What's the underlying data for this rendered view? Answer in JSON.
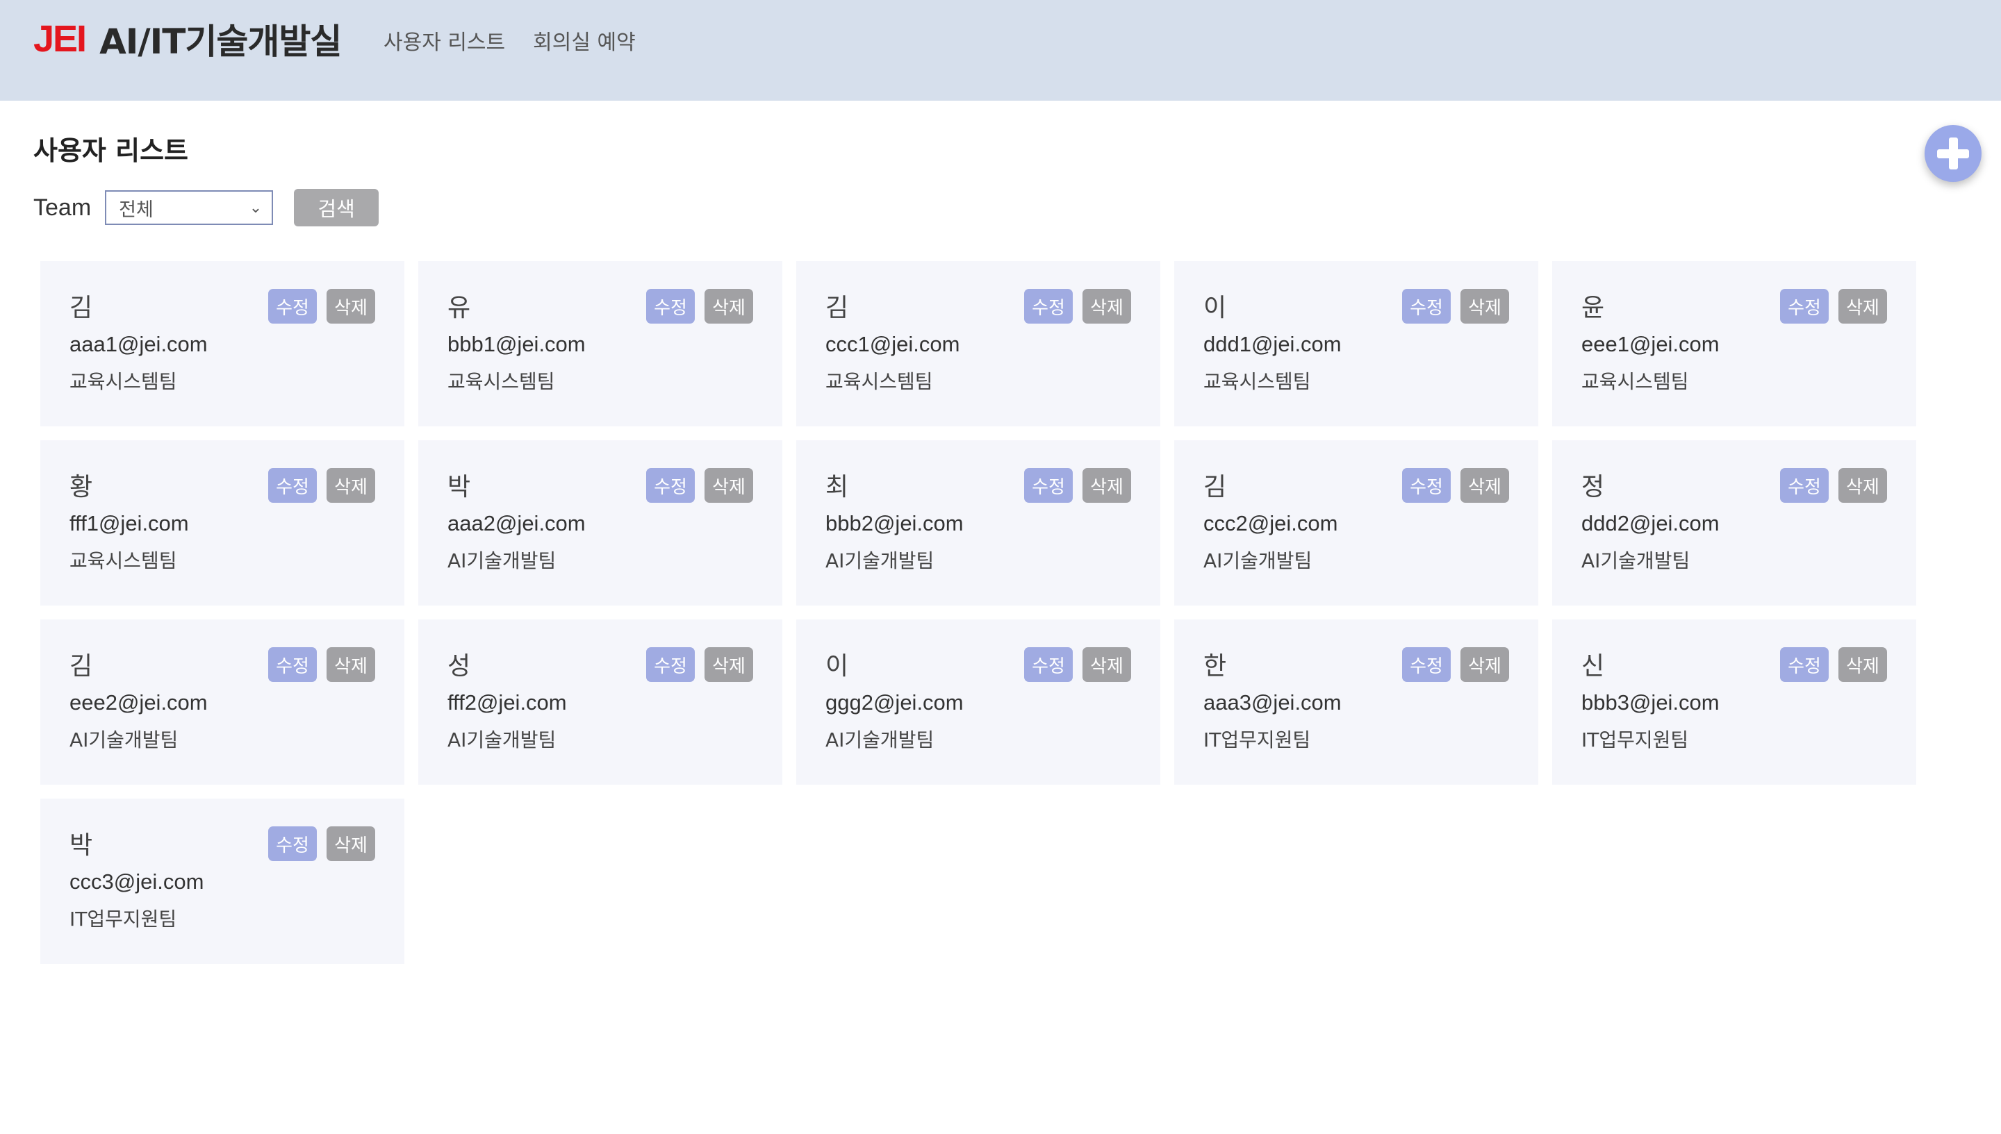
{
  "header": {
    "logo": "JEI",
    "title": "AI/IT기술개발실",
    "nav": [
      "사용자 리스트",
      "회의실 예약"
    ]
  },
  "page_title": "사용자 리스트",
  "filter": {
    "label": "Team",
    "selected": "전체",
    "search_label": "검색"
  },
  "card_actions": {
    "edit": "수정",
    "delete": "삭제"
  },
  "users": [
    {
      "name": "김",
      "email": "aaa1@jei.com",
      "team": "교육시스템팀"
    },
    {
      "name": "유",
      "email": "bbb1@jei.com",
      "team": "교육시스템팀"
    },
    {
      "name": "김",
      "email": "ccc1@jei.com",
      "team": "교육시스템팀"
    },
    {
      "name": "이",
      "email": "ddd1@jei.com",
      "team": "교육시스템팀"
    },
    {
      "name": "윤",
      "email": "eee1@jei.com",
      "team": "교육시스템팀"
    },
    {
      "name": "황",
      "email": "fff1@jei.com",
      "team": "교육시스템팀"
    },
    {
      "name": "박",
      "email": "aaa2@jei.com",
      "team": "AI기술개발팀"
    },
    {
      "name": "최",
      "email": "bbb2@jei.com",
      "team": "AI기술개발팀"
    },
    {
      "name": "김",
      "email": "ccc2@jei.com",
      "team": "AI기술개발팀"
    },
    {
      "name": "정",
      "email": "ddd2@jei.com",
      "team": "AI기술개발팀"
    },
    {
      "name": "김",
      "email": "eee2@jei.com",
      "team": "AI기술개발팀"
    },
    {
      "name": "성",
      "email": "fff2@jei.com",
      "team": "AI기술개발팀"
    },
    {
      "name": "이",
      "email": "ggg2@jei.com",
      "team": "AI기술개발팀"
    },
    {
      "name": "한",
      "email": "aaa3@jei.com",
      "team": "IT업무지원팀"
    },
    {
      "name": "신",
      "email": "bbb3@jei.com",
      "team": "IT업무지원팀"
    },
    {
      "name": "박",
      "email": "ccc3@jei.com",
      "team": "IT업무지원팀"
    }
  ],
  "colors": {
    "header_bg": "#d6dfec",
    "logo_red": "#e4161e",
    "edit_button": "#a0abe2",
    "delete_button": "#a1a1a4",
    "fab": "#9aa9e9",
    "card_bg": "#f5f6fb"
  },
  "icons": {
    "fab": "plus-icon",
    "select": "chevron-down-icon"
  }
}
